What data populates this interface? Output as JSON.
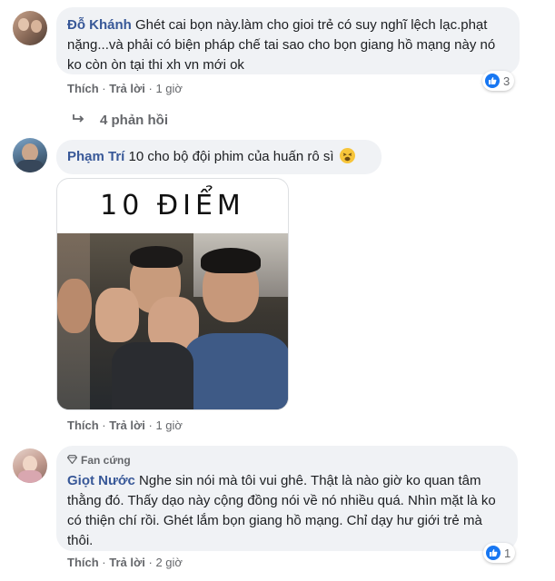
{
  "comments": [
    {
      "author": "Đỗ Khánh",
      "text": "Ghét cai bọn này.làm cho gioi trẻ có suy nghĩ lệch lạc.phạt nặng...và phải có biện pháp chế tai sao cho bọn giang hồ mạng này nó ko còn òn tại thi xh vn mới ok",
      "like_label": "Thích",
      "reply_label": "Trả lời",
      "time": "1 giờ",
      "reaction_count": "3",
      "replies_label": "4 phản hồi"
    },
    {
      "author": "Phạm Trí",
      "text": "10 cho bộ đội phim của huấn rô sì",
      "like_label": "Thích",
      "reply_label": "Trả lời",
      "time": "1 giờ",
      "image_caption": "10 ĐIỂM"
    },
    {
      "badge": "Fan cứng",
      "author": "Giọt Nước",
      "text": "Nghe sin nói mà tôi vui ghê. Thật là nào giờ ko quan tâm thằng đó. Thấy dạo này cộng đồng nói về nó nhiều quá. Nhìn mặt là ko có thiện chí rồi. Ghét lắm bọn giang hồ mạng. Chỉ dạy hư giới trẻ mà thôi.",
      "like_label": "Thích",
      "reply_label": "Trả lời",
      "time": "2 giờ",
      "reaction_count": "1"
    }
  ],
  "separator": "·",
  "colors": {
    "link": "#385898",
    "bubble": "#f0f2f5",
    "like": "#1877f2",
    "meta": "#65676b"
  },
  "icons": [
    "thumbs-up-icon",
    "reply-arrow-icon",
    "tired-face-emoji-icon",
    "diamond-icon"
  ]
}
